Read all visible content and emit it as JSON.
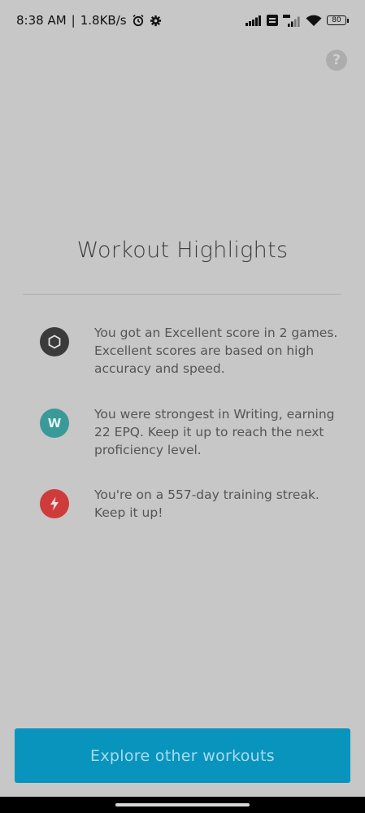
{
  "status_bar": {
    "time": "8:38 AM",
    "separator": "|",
    "speed": "1.8KB/s",
    "battery": "80"
  },
  "help": {
    "label": "?"
  },
  "page": {
    "title": "Workout Highlights"
  },
  "highlights": [
    {
      "icon": "hexagon-icon",
      "badge_color": "#3b3b3b",
      "text": "You got an Excellent score in 2 games. Excellent scores are based on high accuracy and speed."
    },
    {
      "icon": "writing-letter-icon",
      "badge_label": "W",
      "badge_color": "#3a9a97",
      "text": "You were strongest in Writing, earning 22 EPQ. Keep it up to reach the next proficiency level."
    },
    {
      "icon": "lightning-icon",
      "badge_color": "#cf3b3b",
      "text": "You're on a 557-day training streak. Keep it up!"
    }
  ],
  "cta": {
    "label": "Explore other workouts",
    "color": "#0894bd"
  }
}
